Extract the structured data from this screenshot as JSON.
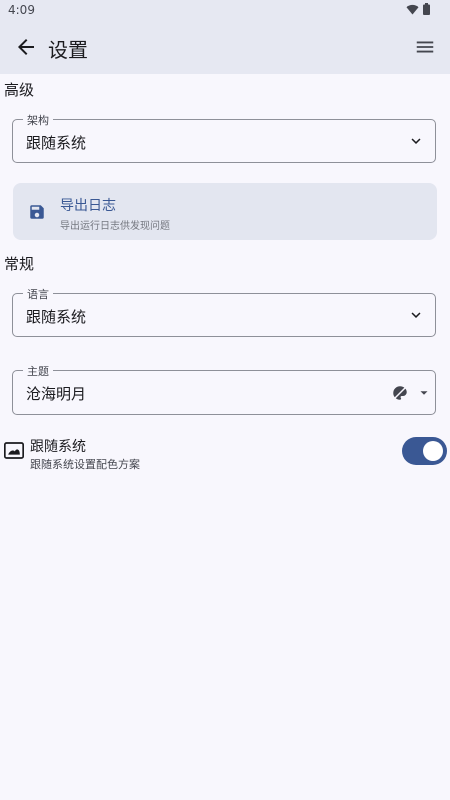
{
  "status": {
    "time": "4:09"
  },
  "appbar": {
    "title": "设置"
  },
  "sections": {
    "advanced": "高级",
    "general": "常规"
  },
  "fields": {
    "arch": {
      "label": "架构",
      "value": "跟随系统"
    },
    "language": {
      "label": "语言",
      "value": "跟随系统"
    },
    "theme": {
      "label": "主题",
      "value": "沧海明月"
    }
  },
  "export": {
    "title": "导出日志",
    "subtitle": "导出运行日志供发现问题"
  },
  "follow_system": {
    "title": "跟随系统",
    "subtitle": "跟随系统设置配色方案",
    "enabled": true
  },
  "colors": {
    "accent": "#3a5894",
    "background": "#f8f7fd",
    "card": "#e3e6f0",
    "appbar": "#e6e8f2"
  }
}
